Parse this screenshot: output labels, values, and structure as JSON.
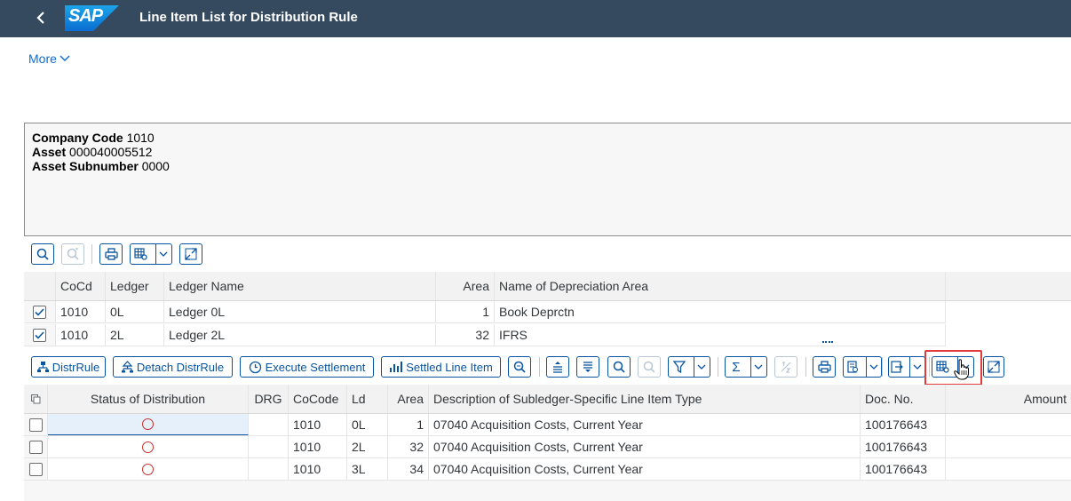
{
  "shell": {
    "title": "Line Item List for Distribution Rule",
    "logo_text": "SAP",
    "brand_color": "#354a5f"
  },
  "more_label": "More",
  "header_info": {
    "company_code_label": "Company Code",
    "company_code_value": "1010",
    "asset_label": "Asset",
    "asset_value": "000040005512",
    "subnumber_label": "Asset Subnumber",
    "subnumber_value": "0000"
  },
  "top_grid": {
    "columns": [
      "CoCd",
      "Ledger",
      "Ledger Name",
      "Area",
      "Name of Depreciation Area"
    ],
    "rows": [
      {
        "checked": true,
        "cocd": "1010",
        "ledger": "0L",
        "ledger_name": "Ledger 0L",
        "area": "1",
        "area_name": "Book Deprctn"
      },
      {
        "checked": true,
        "cocd": "1010",
        "ledger": "2L",
        "ledger_name": "Ledger 2L",
        "area": "32",
        "area_name": "IFRS"
      }
    ]
  },
  "toolbar2": {
    "distrrule": "DistrRule",
    "detach": "Detach DistrRule",
    "execute": "Execute Settlement",
    "settled": "Settled Line Item",
    "sum_symbol": "Σ"
  },
  "bottom_grid": {
    "columns": [
      "Status of Distribution",
      "DRG",
      "CoCode",
      "Ld",
      "Area",
      "Description of Subledger-Specific Line Item Type",
      "Doc. No.",
      "Amount"
    ],
    "rows": [
      {
        "cocode": "1010",
        "ld": "0L",
        "area": "1",
        "desc": "07040 Acquisition Costs, Current Year",
        "doc": "100176643"
      },
      {
        "cocode": "1010",
        "ld": "2L",
        "area": "32",
        "desc": "07040 Acquisition Costs, Current Year",
        "doc": "100176643"
      },
      {
        "cocode": "1010",
        "ld": "3L",
        "area": "34",
        "desc": "07040 Acquisition Costs, Current Year",
        "doc": "100176643"
      }
    ]
  },
  "colors": {
    "accent": "#0854a0",
    "status_red": "#c9302c",
    "highlight": "#e33b3b"
  }
}
